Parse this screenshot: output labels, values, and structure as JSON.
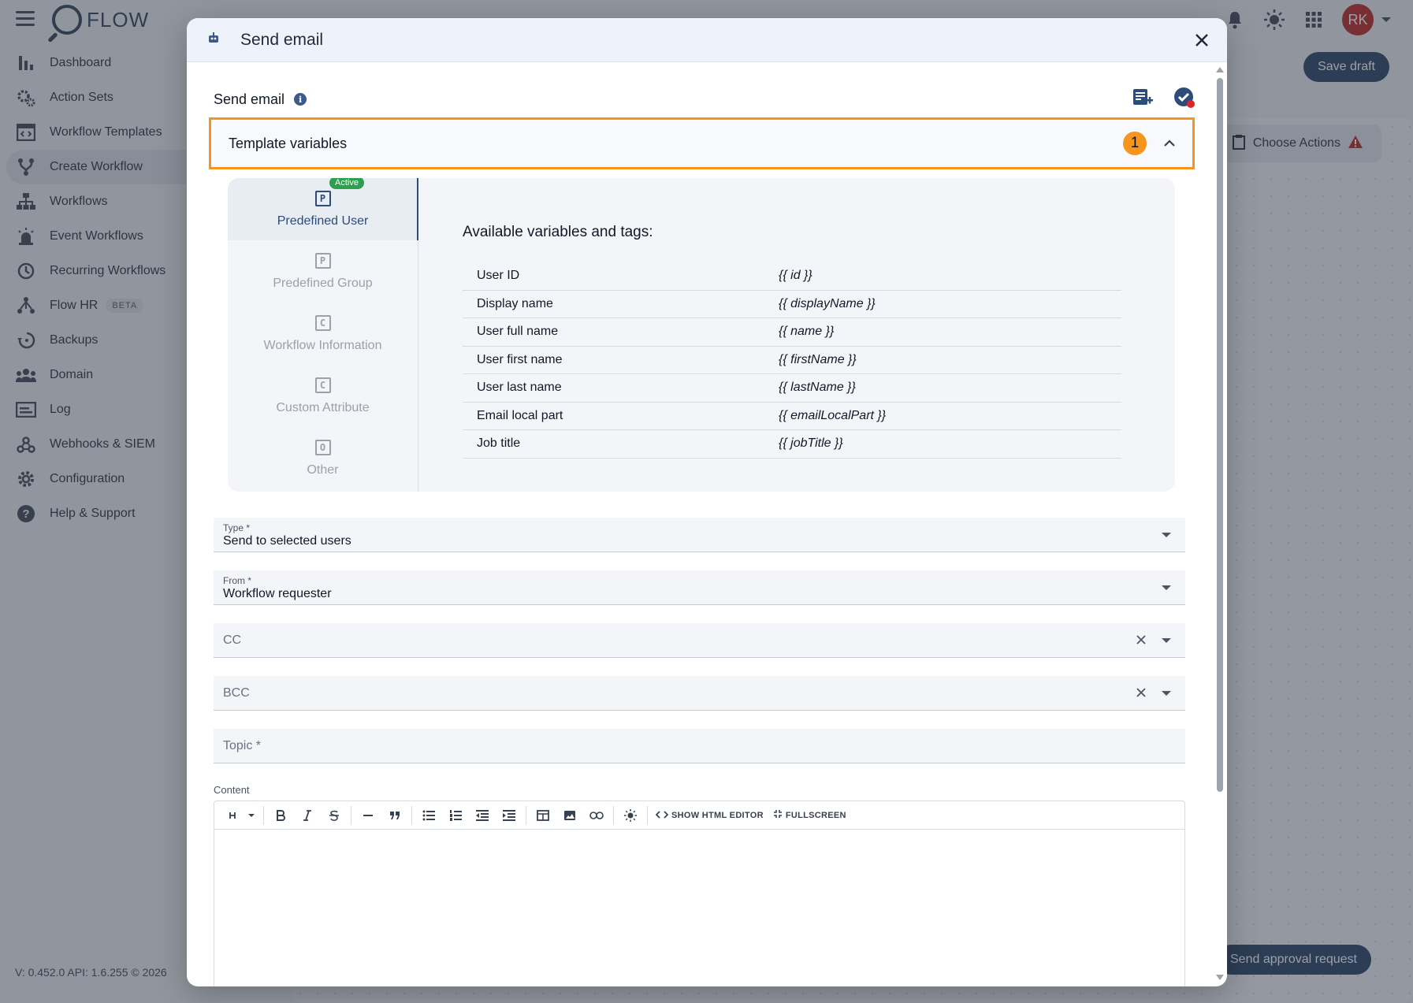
{
  "app": {
    "name": "FLOW",
    "user_initials": "RK",
    "version": "V: 0.452.0   API: 1.6.255   © 2026",
    "save_draft": "Save draft",
    "choose_actions": "Choose Actions",
    "send_approval": "Send approval request"
  },
  "sidebar": {
    "items": [
      {
        "label": "Dashboard",
        "icon": "bar-chart-icon"
      },
      {
        "label": "Action Sets",
        "icon": "gears-icon"
      },
      {
        "label": "Workflow Templates",
        "icon": "template-icon"
      },
      {
        "label": "Create Workflow",
        "icon": "branch-icon"
      },
      {
        "label": "Workflows",
        "icon": "hierarchy-icon"
      },
      {
        "label": "Event Workflows",
        "icon": "alarm-icon"
      },
      {
        "label": "Recurring Workflows",
        "icon": "clock-icon"
      },
      {
        "label": "Flow HR",
        "icon": "people-tree-icon",
        "badge": "BETA"
      },
      {
        "label": "Backups",
        "icon": "history-icon"
      },
      {
        "label": "Domain",
        "icon": "group-icon"
      },
      {
        "label": "Log",
        "icon": "log-icon"
      },
      {
        "label": "Webhooks & SIEM",
        "icon": "webhook-icon"
      },
      {
        "label": "Configuration",
        "icon": "gear-icon"
      },
      {
        "label": "Help & Support",
        "icon": "help-icon"
      }
    ],
    "active_index": 3
  },
  "modal": {
    "title": "Send email",
    "section_title": "Send email",
    "template_variables": {
      "label": "Template variables",
      "count": "1",
      "active_badge": "Active",
      "tabs": [
        {
          "label": "Predefined User",
          "glyph": "P"
        },
        {
          "label": "Predefined Group",
          "glyph": "P"
        },
        {
          "label": "Workflow Information",
          "glyph": "C"
        },
        {
          "label": "Custom Attribute",
          "glyph": "C"
        },
        {
          "label": "Other",
          "glyph": "O"
        }
      ],
      "available_title": "Available variables and tags:",
      "rows": [
        {
          "name": "User ID",
          "tag": "{{ id }}"
        },
        {
          "name": "Display name",
          "tag": "{{ displayName }}"
        },
        {
          "name": "User full name",
          "tag": "{{ name }}"
        },
        {
          "name": "User first name",
          "tag": "{{ firstName }}"
        },
        {
          "name": "User last name",
          "tag": "{{ lastName }}"
        },
        {
          "name": "Email local part",
          "tag": "{{ emailLocalPart }}"
        },
        {
          "name": "Job title",
          "tag": "{{ jobTitle }}"
        }
      ]
    },
    "fields": {
      "type_label": "Type *",
      "type_value": "Send to selected users",
      "from_label": "From *",
      "from_value": "Workflow requester",
      "cc_placeholder": "CC",
      "bcc_placeholder": "BCC",
      "topic_placeholder": "Topic *",
      "content_label": "Content"
    },
    "toolbar": {
      "show_html": "SHOW HTML EDITOR",
      "fullscreen": "FULLSCREEN"
    }
  },
  "colors": {
    "accent_orange": "#f7941d",
    "primary_navy": "#1e3a5f",
    "active_green": "#2e9e4f",
    "avatar_red": "#b91c1c"
  }
}
